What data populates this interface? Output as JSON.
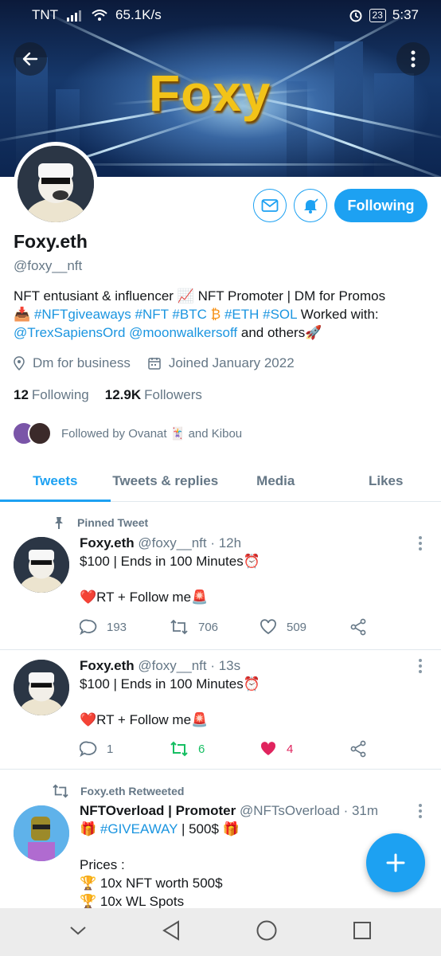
{
  "status": {
    "carrier": "TNT",
    "speed": "65.1K/s",
    "battery": "23",
    "time": "5:37"
  },
  "banner": {
    "title": "Foxy"
  },
  "profile": {
    "name": "Foxy.eth",
    "handle": "@foxy__nft",
    "bio": {
      "l1": "NFT entusiant & influencer 📈 NFT Promoter | DM for Promos",
      "l2_icon": "📥",
      "l2_tags": "#NFTgiveaways #NFT #BTC",
      "l2_btc": "₿",
      "l2_tags2": "#ETH #SOL",
      "l2_end": "Worked with:",
      "l3_mentions": "@TrexSapiensOrd @moonwalkersoff",
      "l3_end": "and others🚀"
    },
    "location": "Dm for business",
    "joined": "Joined January 2022",
    "following_count": "12",
    "following_label": "Following",
    "followers_count": "12.9K",
    "followers_label": "Followers",
    "followed_by": "Followed by Ovanat 🃏 and Kibou",
    "follow_button": "Following"
  },
  "tabs": [
    "Tweets",
    "Tweets & replies",
    "Media",
    "Likes"
  ],
  "tweets": [
    {
      "context": "Pinned Tweet",
      "name": "Foxy.eth",
      "meta": "@foxy__nft · 12h",
      "line1": "$100 | Ends in 100 Minutes⏰",
      "line2": "❤️RT + Follow me🚨",
      "replies": "193",
      "retweets": "706",
      "likes": "509"
    },
    {
      "name": "Foxy.eth",
      "meta": "@foxy__nft · 13s",
      "line1": "$100 | Ends in 100 Minutes⏰",
      "line2": "❤️RT + Follow me🚨",
      "replies": "1",
      "retweets": "6",
      "likes": "4"
    },
    {
      "context": "Foxy.eth Retweeted",
      "name": "NFTOverload | Promoter",
      "meta": "@NFTsOverload · 31m",
      "line1_pre": "🎁",
      "line1_tag": "#GIVEAWAY",
      "line1_post": "| 500$ 🎁",
      "line2": "Prices :",
      "line3": "🏆 10x NFT worth 500$",
      "line4": "🏆 10x WL Spots"
    }
  ],
  "colors": {
    "accent": "#1da1f2",
    "like": "#e0245e",
    "retweet": "#17bf63"
  },
  "icons": [
    "back-arrow-icon",
    "more-vertical-icon",
    "mail-icon",
    "bell-icon",
    "location-icon",
    "calendar-icon",
    "pin-icon",
    "reply-icon",
    "retweet-icon",
    "heart-icon",
    "share-icon",
    "compose-plus-icon"
  ]
}
